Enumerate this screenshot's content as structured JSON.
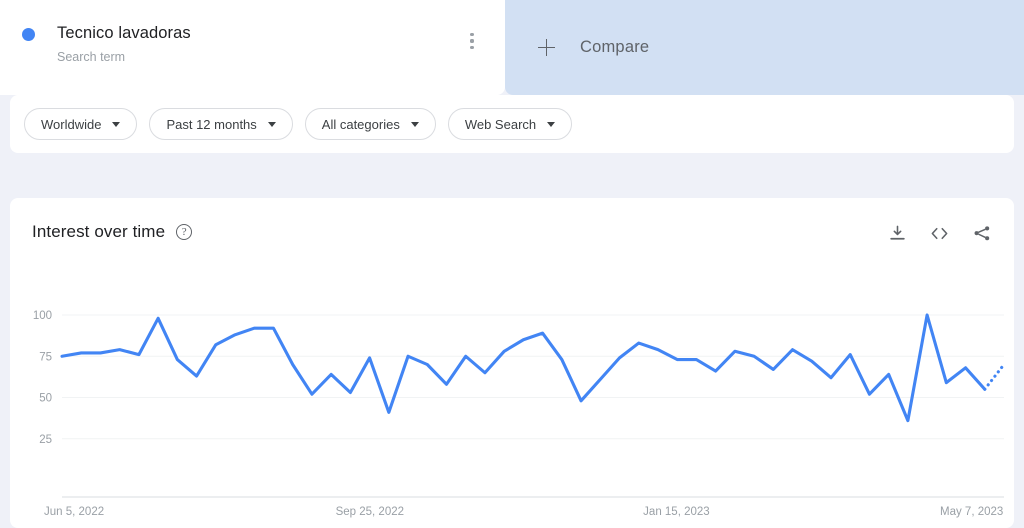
{
  "term": {
    "title": "Tecnico lavadoras",
    "subtitle": "Search term",
    "dot_color": "#4285f4",
    "menu_icon": "kebab-menu-icon"
  },
  "compare": {
    "label": "Compare",
    "icon": "plus-icon"
  },
  "filters": [
    {
      "label": "Worldwide",
      "name": "filter-location"
    },
    {
      "label": "Past 12 months",
      "name": "filter-time-range"
    },
    {
      "label": "All categories",
      "name": "filter-category"
    },
    {
      "label": "Web Search",
      "name": "filter-search-type"
    }
  ],
  "chart_panel": {
    "title": "Interest over time",
    "help_icon": "question-mark-icon",
    "help_glyph": "?",
    "actions": [
      {
        "name": "download-csv-icon",
        "tooltip": "Download"
      },
      {
        "name": "embed-code-icon",
        "tooltip": "Embed"
      },
      {
        "name": "share-icon",
        "tooltip": "Share"
      }
    ]
  },
  "chart_data": {
    "type": "line",
    "title": "Interest over time",
    "xlabel": "",
    "ylabel": "",
    "ylim": [
      0,
      100
    ],
    "yticks": [
      25,
      50,
      75,
      100
    ],
    "grid": true,
    "legend": false,
    "line_color": "#4285f4",
    "xtick_labels": [
      "Jun 5, 2022",
      "Sep 25, 2022",
      "Jan 15, 2023",
      "May 7, 2023"
    ],
    "xtick_positions": [
      0,
      16,
      32,
      48
    ],
    "partial_data_from_index": 48,
    "series": [
      {
        "name": "Tecnico lavadoras",
        "values": [
          75,
          77,
          77,
          79,
          76,
          98,
          73,
          63,
          82,
          88,
          92,
          92,
          70,
          52,
          64,
          53,
          74,
          41,
          75,
          70,
          58,
          75,
          65,
          78,
          85,
          89,
          73,
          48,
          61,
          74,
          83,
          79,
          73,
          73,
          66,
          78,
          75,
          67,
          79,
          72,
          62,
          76,
          52,
          64,
          36,
          100,
          59,
          68,
          55,
          70
        ]
      }
    ]
  }
}
